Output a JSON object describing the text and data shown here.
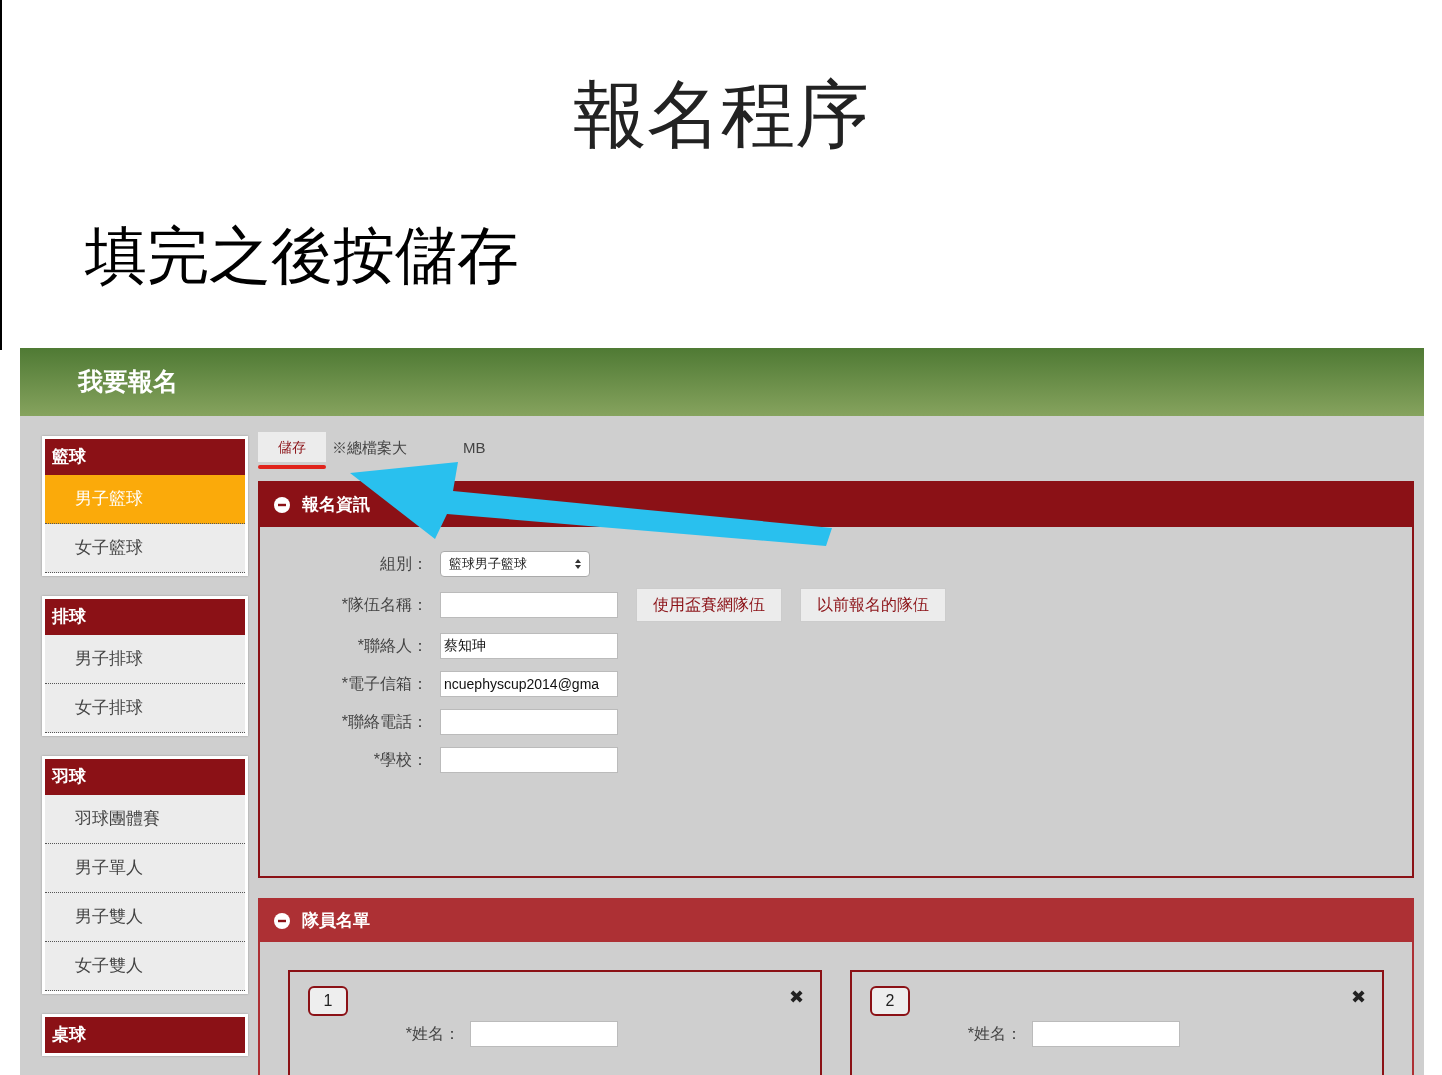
{
  "slide": {
    "title": "報名程序",
    "subtitle": "填完之後按儲存"
  },
  "app": {
    "header": "我要報名",
    "sidebar": [
      {
        "title": "籃球",
        "items": [
          {
            "label": "男子籃球",
            "selected": true
          },
          {
            "label": "女子籃球",
            "selected": false
          }
        ]
      },
      {
        "title": "排球",
        "items": [
          {
            "label": "男子排球",
            "selected": false
          },
          {
            "label": "女子排球",
            "selected": false
          }
        ]
      },
      {
        "title": "羽球",
        "items": [
          {
            "label": "羽球團體賽",
            "selected": false
          },
          {
            "label": "男子單人",
            "selected": false
          },
          {
            "label": "男子雙人",
            "selected": false
          },
          {
            "label": "女子雙人",
            "selected": false
          }
        ]
      },
      {
        "title": "桌球"
      }
    ],
    "toolbar": {
      "save_button": "儲存",
      "note_parts": [
        "※總檔案大",
        "MB"
      ]
    },
    "info_section": {
      "title": "報名資訊",
      "expanded": true,
      "fields": [
        {
          "kind": "select",
          "label": "組別：",
          "value": "籃球男子籃球"
        },
        {
          "kind": "input",
          "label": "*隊伍名稱：",
          "buttons": [
            "使用盃賽網隊伍",
            "以前報名的隊伍"
          ]
        },
        {
          "kind": "input",
          "label": "*聯絡人：",
          "value": "蔡知珅"
        },
        {
          "kind": "input",
          "label": "*電子信箱：",
          "value": "ncuephyscup2014@gma"
        },
        {
          "kind": "input",
          "label": "*聯絡電話："
        },
        {
          "kind": "input",
          "label": "*學校："
        }
      ]
    },
    "members_section": {
      "title": "隊員名單",
      "expanded": true,
      "members": [
        {
          "number": "1",
          "remove": "✖",
          "fields": [
            "*姓名："
          ]
        },
        {
          "number": "2",
          "remove": "✖",
          "fields": [
            "*姓名："
          ]
        }
      ]
    }
  }
}
